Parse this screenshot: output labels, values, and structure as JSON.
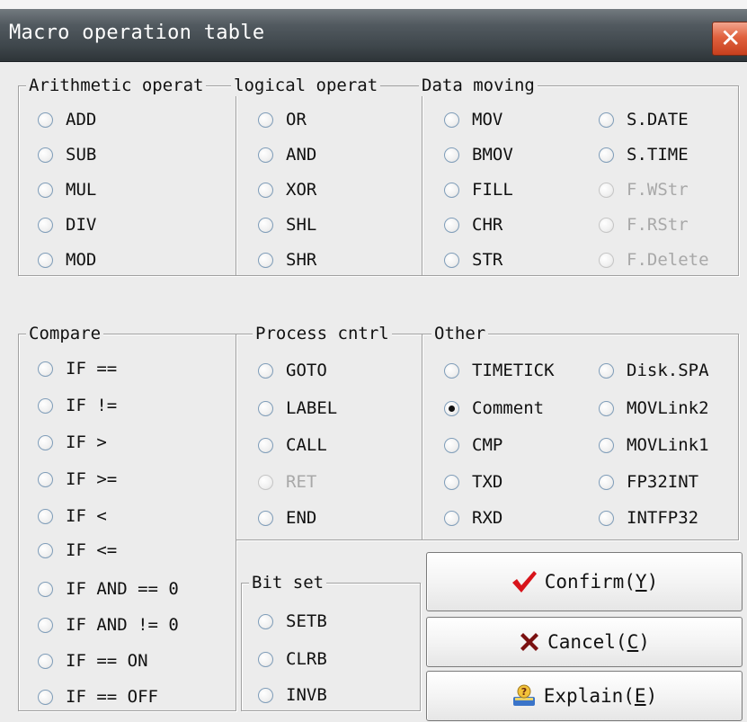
{
  "window": {
    "title": "Macro operation table"
  },
  "groups": {
    "arithmetic": {
      "title": "Arithmetic operat",
      "options": [
        "ADD",
        "SUB",
        "MUL",
        "DIV",
        "MOD"
      ]
    },
    "logical": {
      "title": "logical operat",
      "options": [
        "OR",
        "AND",
        "XOR",
        "SHL",
        "SHR"
      ]
    },
    "data_moving": {
      "title": "Data moving",
      "options_col1": [
        "MOV",
        "BMOV",
        "FILL",
        "CHR",
        "STR"
      ],
      "options_col2": [
        "S.DATE",
        "S.TIME",
        "F.WStr",
        "F.RStr",
        "F.Delete"
      ],
      "disabled_col2": [
        "F.WStr",
        "F.RStr",
        "F.Delete"
      ]
    },
    "compare": {
      "title": "Compare",
      "options": [
        "IF ==",
        "IF !=",
        "IF >",
        "IF >=",
        "IF <",
        "IF <=",
        "IF AND == 0",
        "IF AND != 0",
        "IF == ON",
        "IF == OFF"
      ]
    },
    "process": {
      "title": "Process cntrl",
      "options": [
        "GOTO",
        "LABEL",
        "CALL",
        "RET",
        "END"
      ],
      "disabled": [
        "RET"
      ]
    },
    "other": {
      "title": "Other",
      "options_col1": [
        "TIMETICK",
        "Comment",
        "CMP",
        "TXD",
        "RXD"
      ],
      "options_col2": [
        "Disk.SPA",
        "MOVLink2",
        "MOVLink1",
        "FP32INT",
        "INTFP32"
      ],
      "selected": "Comment"
    },
    "bitset": {
      "title": "Bit set",
      "options": [
        "SETB",
        "CLRB",
        "INVB"
      ]
    }
  },
  "buttons": {
    "confirm": {
      "label": "Confirm(",
      "key": "Y",
      "end": ")"
    },
    "cancel": {
      "label": "Cancel(",
      "key": "C",
      "end": ")"
    },
    "explain": {
      "label": "Explain(",
      "key": "E",
      "end": ")"
    }
  },
  "icons": {
    "close": "close-icon",
    "confirm": "checkmark-icon",
    "cancel": "x-mark-icon",
    "explain": "help-book-icon"
  },
  "colors": {
    "confirm_check": "#d8141b",
    "cancel_x": "#7a1010",
    "close_button": "#e0623f"
  }
}
